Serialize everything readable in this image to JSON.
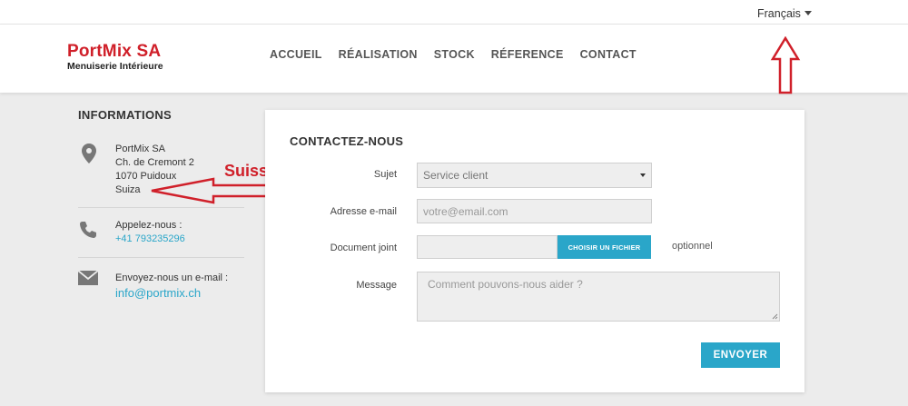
{
  "language": {
    "label": "Français"
  },
  "logo": {
    "brand": "PortMix SA",
    "tagline": "Menuiserie Intérieure",
    "brand_color": "#d0202a"
  },
  "nav": {
    "items": [
      "ACCUEIL",
      "RÉALISATION",
      "STOCK",
      "RÉFERENCE",
      "CONTACT"
    ]
  },
  "annotation": {
    "text": "Suisse",
    "color": "#d0202a"
  },
  "info": {
    "title": "INFORMATIONS",
    "address": {
      "line1": "PortMix SA",
      "line2": "Ch. de Cremont 2",
      "line3": "1070 Puidoux",
      "line4": "Suiza",
      "icon": "map-pin-icon"
    },
    "phone": {
      "label": "Appelez-nous :",
      "value": "+41 793235296",
      "icon": "phone-icon"
    },
    "email": {
      "label": "Envoyez-nous un e-mail :",
      "value": "info@portmix.ch",
      "icon": "envelope-icon"
    }
  },
  "form": {
    "title": "CONTACTEZ-NOUS",
    "subject": {
      "label": "Sujet",
      "value": "Service client"
    },
    "email": {
      "label": "Adresse e-mail",
      "placeholder": "votre@email.com"
    },
    "attachment": {
      "label": "Document joint",
      "button": "CHOISIR UN FICHIER",
      "hint": "optionnel"
    },
    "message": {
      "label": "Message",
      "placeholder": "Comment pouvons-nous aider ?"
    },
    "submit": "ENVOYER",
    "accent": "#2aa6c9"
  }
}
